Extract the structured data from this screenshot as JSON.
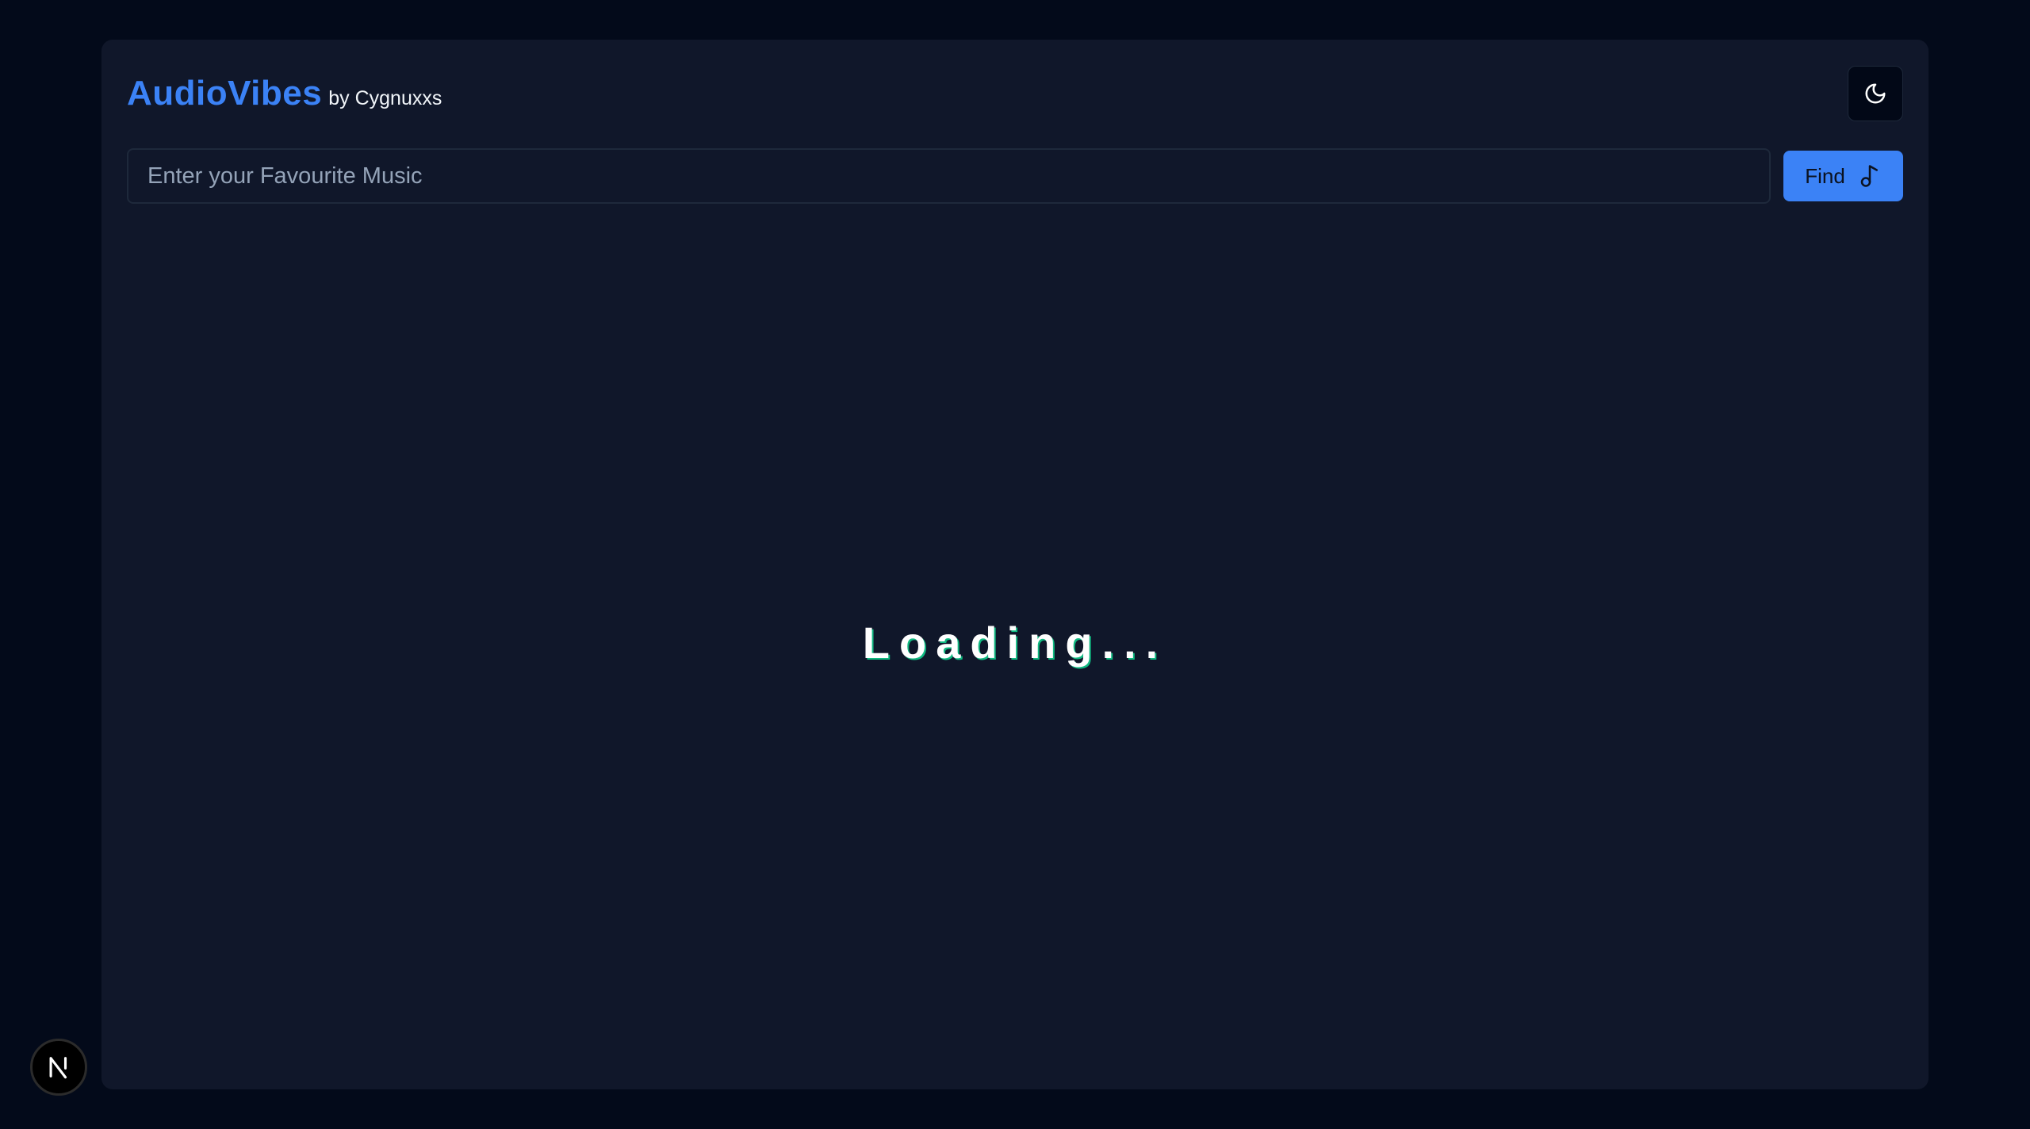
{
  "header": {
    "title": "AudioVibes",
    "subtitle": "by Cygnuxxs",
    "theme_toggle_icon": "moon-icon"
  },
  "search": {
    "placeholder": "Enter your Favourite Music",
    "value": "",
    "button_label": "Find",
    "button_icon": "music-note-icon"
  },
  "main": {
    "loading_text": "Loading..."
  },
  "dev_badge": {
    "label": "N",
    "icon": "nextjs-logo-icon"
  },
  "colors": {
    "page_background": "#030a1a",
    "panel_background": "#10172a",
    "accent": "#3b82f6",
    "loading_shadow": "#10b981"
  }
}
